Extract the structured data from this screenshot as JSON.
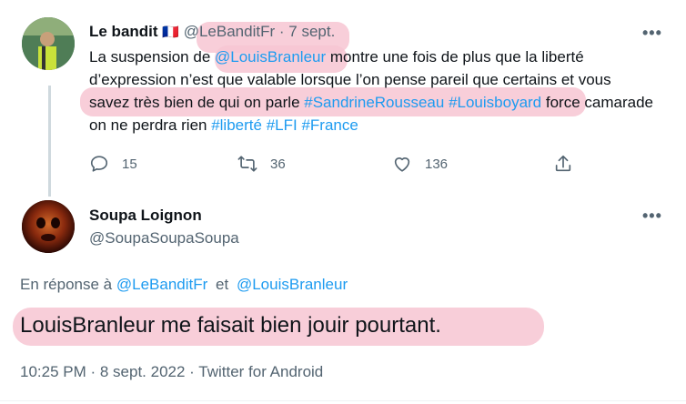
{
  "tweet1": {
    "author_name": "Le bandit",
    "flag": "🇫🇷",
    "handle": "@LeBanditFr",
    "separator": "·",
    "date": "7 sept.",
    "more": "•••",
    "text": {
      "p1": "La suspension de ",
      "mention1": "@LouisBranleur",
      "p2": " montre une fois de plus que la liberté d’expression n’est que valable lorsque l’on pense pareil que certains et vous savez très bien de qui on parle ",
      "hashtag1": "#SandrineRousseau",
      "space1": " ",
      "hashtag2": "#Louisboyard",
      "p3": " force camarade on ne perdra rien ",
      "hashtag3": "#liberté",
      "space2": " ",
      "hashtag4": "#LFI",
      "space3": " ",
      "hashtag5": "#France"
    },
    "actions": {
      "replies": "15",
      "retweets": "36",
      "likes": "136"
    },
    "icons": {
      "reply": "reply-icon",
      "retweet": "retweet-icon",
      "like": "heart-icon",
      "share": "share-icon"
    }
  },
  "tweet2": {
    "author_name": "Soupa Loignon",
    "handle": "@SoupaSoupaSoupa",
    "more": "•••",
    "reply_prefix": "En réponse à",
    "reply_to1": "@LeBanditFr",
    "reply_and": "et",
    "reply_to2": "@LouisBranleur",
    "text": "LouisBranleur me faisait bien jouir pourtant.",
    "meta": "10:25 PM · 8 sept. 2022 · Twitter for Android"
  },
  "colors": {
    "link": "#1d9bf0",
    "muted": "#536471",
    "highlight": "#f7c6d2"
  }
}
